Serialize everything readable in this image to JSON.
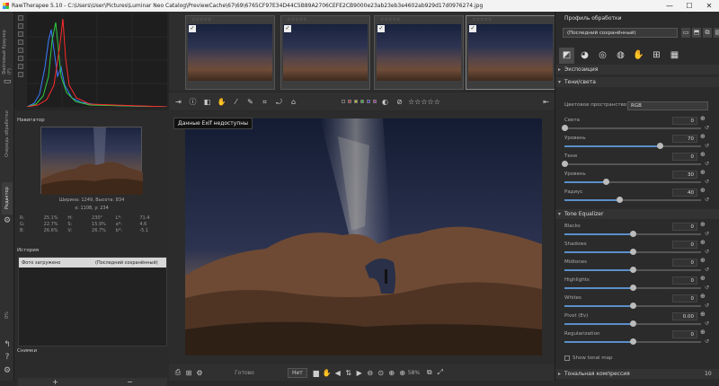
{
  "window": {
    "title": "RawTherapee 5.10 - C:\\Users\\User\\Pictures\\Luminar Neo Catalog\\PreviewCache\\67\\69\\6765CF97E34D44C5B89A2706CEFE2CB9000e23ab23eb3e4602ab929d17d0976274.jpg",
    "minimize": "—",
    "maximize": "☐",
    "close": "✕"
  },
  "left_tabs": [
    "Файловый браузер (F)",
    "Очередь обработки",
    "Редактор"
  ],
  "left_percent": "0%",
  "navigator": {
    "title": "Навигатор",
    "dims": "Ширина: 1249, Высота: 834",
    "coords": "x: 1108, y: 234",
    "rows": [
      [
        "R:",
        "25.1%",
        "H:",
        "230°",
        "L*:",
        "71.4"
      ],
      [
        "G:",
        "22.7%",
        "S:",
        "15.9%",
        "a*:",
        "4.6"
      ],
      [
        "B:",
        "26.6%",
        "V:",
        "26.7%",
        "b*:",
        "-5.1"
      ]
    ]
  },
  "history": {
    "title": "История",
    "row": [
      "Фото загружено",
      "(Последний сохранённый)"
    ]
  },
  "snapshots": {
    "title": "Снимки",
    "add": "+",
    "remove": "−"
  },
  "tooltip": "Данные Exif недоступны",
  "bottombar": {
    "status": "Готово",
    "preview_mode": "Нет",
    "zoom": "58%"
  },
  "right": {
    "profile_title": "Профиль обработки",
    "profile_value": "(Последний сохранённый)",
    "sections": {
      "exposure": "Экспозиция",
      "shadows": "Тени/света",
      "tone_eq": "Tone Equalizer",
      "tonal": "Тональная компрессия"
    },
    "colorspace_label": "Цветовое пространство",
    "colorspace_value": "RGB",
    "shadows_sliders": [
      {
        "label": "Света",
        "value": "0",
        "level": 0.0
      },
      {
        "label": "Уровень",
        "value": "70",
        "level": 0.7
      },
      {
        "label": "Тени",
        "value": "0",
        "level": 0.0
      },
      {
        "label": "Уровень",
        "value": "30",
        "level": 0.3
      },
      {
        "label": "Радиус",
        "value": "40",
        "level": 0.4
      }
    ],
    "toneeq_sliders": [
      {
        "label": "Blacks",
        "value": "0",
        "level": 0.5
      },
      {
        "label": "Shadows",
        "value": "0",
        "level": 0.5
      },
      {
        "label": "Midtones",
        "value": "0",
        "level": 0.5
      },
      {
        "label": "Highlights",
        "value": "0",
        "level": 0.5
      },
      {
        "label": "Whites",
        "value": "0",
        "level": 0.5
      },
      {
        "label": "Pivot (Ev)",
        "value": "0.00",
        "level": 0.5
      },
      {
        "label": "Regularization",
        "value": "0",
        "level": 0.5
      }
    ],
    "show_tonal_map": "Show tonal map",
    "tonal_value": "10"
  },
  "icons": {
    "left": [
      "back-arrow-icon",
      "help-icon",
      "settings-icon"
    ],
    "tools": [
      "exposure-icon",
      "color-icon",
      "detail-icon",
      "advanced-icon",
      "transform-icon",
      "raw-icon",
      "metadata-icon"
    ]
  }
}
